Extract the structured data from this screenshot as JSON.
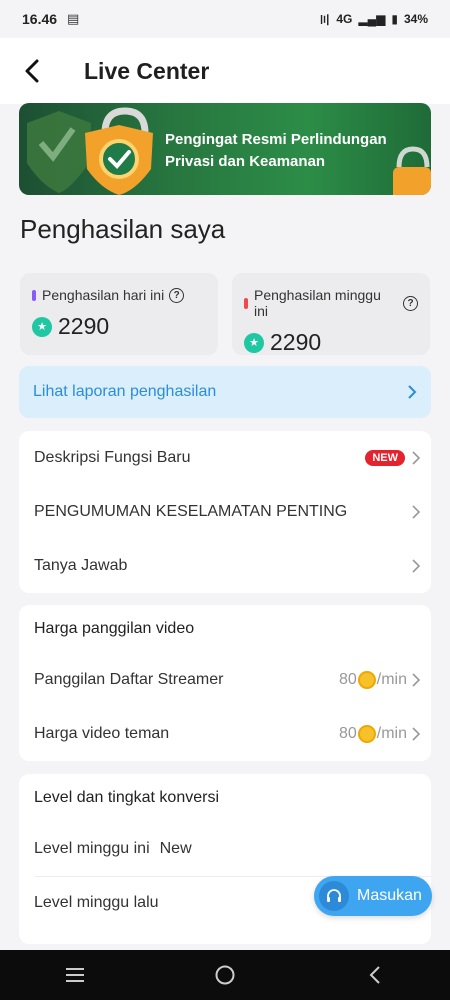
{
  "status": {
    "time": "16.46",
    "network": "4G",
    "battery": "34%"
  },
  "header": {
    "title": "Live Center"
  },
  "banner": {
    "line1": "Pengingat Resmi Perlindungan",
    "line2": "Privasi dan Keamanan"
  },
  "income": {
    "title": "Penghasilan saya",
    "today": {
      "label": "Penghasilan hari ini",
      "value": "2290",
      "color": "#8a5cf6"
    },
    "week": {
      "label": "Penghasilan minggu ini",
      "value": "2290",
      "color": "#ef4a4a"
    }
  },
  "report": {
    "label": "Lihat laporan penghasilan"
  },
  "menu": {
    "items": [
      {
        "label": "Deskripsi Fungsi Baru",
        "badge": "NEW"
      },
      {
        "label": "PENGUMUMAN KESELAMATAN PENTING"
      },
      {
        "label": "Tanya Jawab"
      }
    ]
  },
  "video_price": {
    "title": "Harga panggilan video",
    "rows": [
      {
        "label": "Panggilan Daftar Streamer",
        "price": "80",
        "unit": "/min"
      },
      {
        "label": "Harga video teman",
        "price": "80",
        "unit": "/min"
      }
    ]
  },
  "level": {
    "title": "Level dan tingkat konversi",
    "this_week_label": "Level minggu ini",
    "this_week_value": "New",
    "last_week_label": "Level minggu lalu"
  },
  "fab": {
    "label": "Masukan"
  }
}
